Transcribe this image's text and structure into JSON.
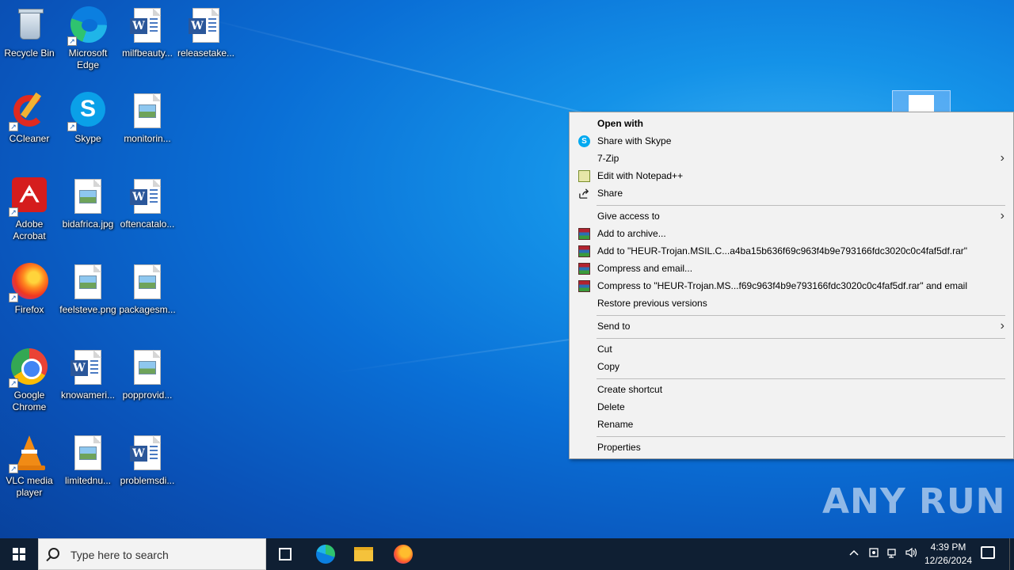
{
  "desktop": {
    "icons": [
      {
        "label": "Recycle Bin"
      },
      {
        "label": "Microsoft Edge"
      },
      {
        "label": "milfbeauty..."
      },
      {
        "label": "releasetake..."
      },
      {
        "label": "CCleaner"
      },
      {
        "label": "Skype"
      },
      {
        "label": "monitorin..."
      },
      {
        "label": "Adobe Acrobat"
      },
      {
        "label": "bidafrica.jpg"
      },
      {
        "label": "oftencatalo..."
      },
      {
        "label": "Firefox"
      },
      {
        "label": "feelsteve.png"
      },
      {
        "label": "packagesm..."
      },
      {
        "label": "Google Chrome"
      },
      {
        "label": "knowameri..."
      },
      {
        "label": "popprovid..."
      },
      {
        "label": "VLC media player"
      },
      {
        "label": "limitednu..."
      },
      {
        "label": "problemsdi..."
      }
    ]
  },
  "context_menu": {
    "items": [
      {
        "label": "Open with"
      },
      {
        "label": "Share with Skype"
      },
      {
        "label": "7-Zip"
      },
      {
        "label": "Edit with Notepad++"
      },
      {
        "label": "Share"
      },
      {
        "label": "Give access to"
      },
      {
        "label": "Add to archive..."
      },
      {
        "label": "Add to \"HEUR-Trojan.MSIL.C...a4ba15b636f69c963f4b9e793166fdc3020c0c4faf5df.rar\""
      },
      {
        "label": "Compress and email..."
      },
      {
        "label": "Compress to \"HEUR-Trojan.MS...f69c963f4b9e793166fdc3020c0c4faf5df.rar\" and email"
      },
      {
        "label": "Restore previous versions"
      },
      {
        "label": "Send to"
      },
      {
        "label": "Cut"
      },
      {
        "label": "Copy"
      },
      {
        "label": "Create shortcut"
      },
      {
        "label": "Delete"
      },
      {
        "label": "Rename"
      },
      {
        "label": "Properties"
      }
    ]
  },
  "watermark": "ANY RUN",
  "taskbar": {
    "search_placeholder": "Type here to search",
    "time": "4:39 PM",
    "date": "12/26/2024"
  },
  "colors": {
    "taskbar": "#0f1f33",
    "menu_bg": "#f2f2f2"
  }
}
